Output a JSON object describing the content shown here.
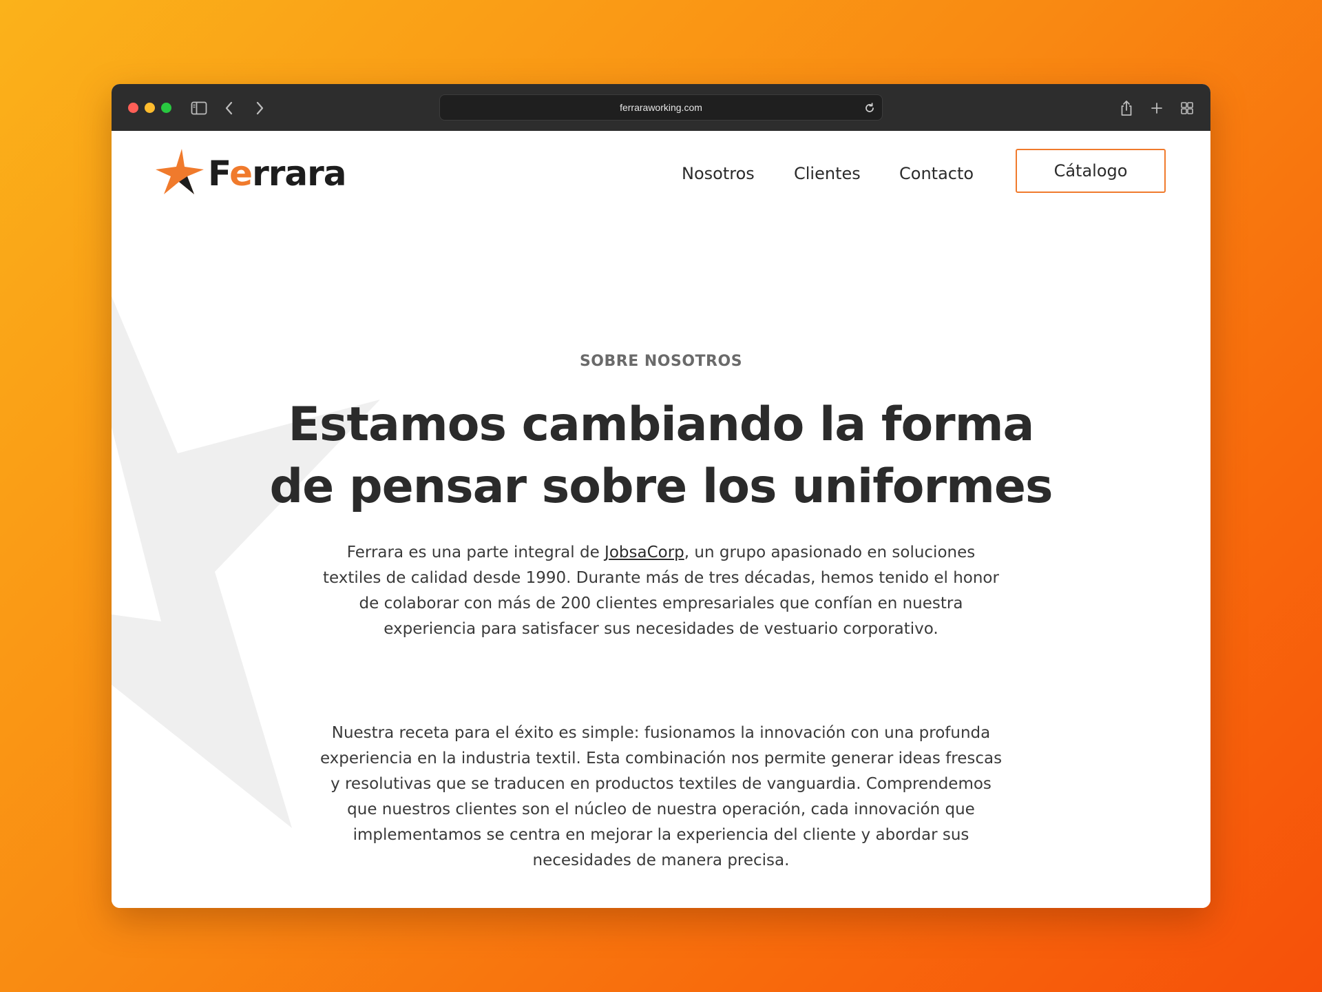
{
  "browser": {
    "url": "ferraraworking.com"
  },
  "header": {
    "logo_text_first": "F",
    "logo_text_accent": "e",
    "logo_text_rest": "rrara",
    "nav": [
      "Nosotros",
      "Clientes",
      "Contacto"
    ],
    "cta": "Cátalogo"
  },
  "about": {
    "eyebrow": "SOBRE NOSOTROS",
    "headline_line1": "Estamos cambiando la forma",
    "headline_line2": "de pensar sobre los uniformes",
    "p1_before": "Ferrara es una parte integral de ",
    "p1_link": "JobsaCorp",
    "p1_after": ", un grupo apasionado en soluciones textiles de calidad desde 1990. Durante más de tres décadas, hemos tenido el honor de colaborar con más de 200 clientes empresariales que confían en nuestra experiencia para satisfacer sus necesidades de vestuario corporativo.",
    "p2": "Nuestra receta para el éxito es simple: fusionamos la innovación con una profunda experiencia en la industria textil. Esta combinación nos permite generar ideas frescas y resolutivas que se traducen en productos textiles de vanguardia. Comprendemos que nuestros clientes son el núcleo de nuestra operación, cada innovación que implementamos se centra en mejorar la experiencia del cliente y abordar sus necesidades de manera precisa."
  },
  "colors": {
    "accent": "#f07a2c",
    "text": "#2b2b2b",
    "background_gradient_start": "#fbb21a",
    "background_gradient_end": "#f6500a"
  }
}
